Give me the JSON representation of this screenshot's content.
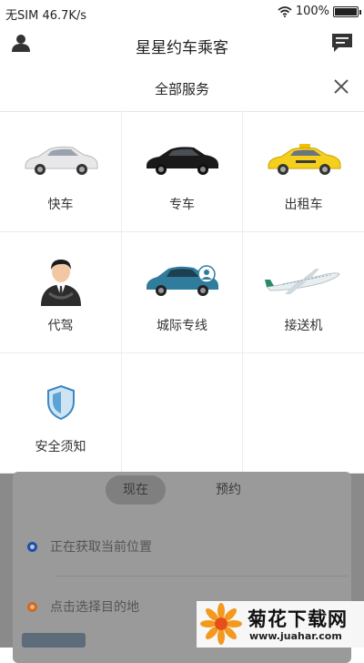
{
  "status_bar": {
    "carrier": "无SIM",
    "speed": "46.7K/s",
    "battery": "100%",
    "battery_level": 1.0
  },
  "header": {
    "title": "星星约车乘客",
    "left_icon": "user-icon",
    "right_icon": "message-icon"
  },
  "panel": {
    "title": "全部服务",
    "close_icon": "close-icon",
    "services": [
      {
        "label": "快车",
        "icon": "white-car"
      },
      {
        "label": "专车",
        "icon": "black-car"
      },
      {
        "label": "出租车",
        "icon": "taxi"
      },
      {
        "label": "代驾",
        "icon": "driver-person"
      },
      {
        "label": "城际专线",
        "icon": "intercity-car"
      },
      {
        "label": "接送机",
        "icon": "airplane"
      },
      {
        "label": "安全须知",
        "icon": "shield"
      }
    ]
  },
  "background": {
    "tabs": [
      "现在",
      "预约"
    ],
    "active_tab": "现在",
    "pickup_text": "正在获取当前位置",
    "destination_text": "点击选择目的地"
  },
  "watermark": {
    "title": "菊花下载网",
    "url": "www.juahar.com"
  },
  "colors": {
    "pickup_dot": "#1e4fa8",
    "destination_dot": "#d2691e",
    "overlay": "#8a8a8a"
  }
}
